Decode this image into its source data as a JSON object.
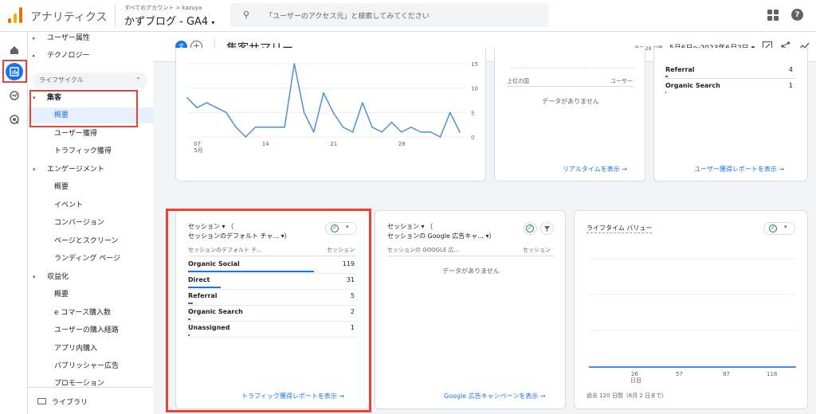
{
  "topbar": {
    "app_title": "アナリティクス",
    "breadcrumb": "すべてのアカウント > kazuya",
    "property": "かずブログ - GA4",
    "search_placeholder": "「ユーザーのアクセス元」と検索してみてください"
  },
  "nav": {
    "items": [
      {
        "label": "ユーザー属性",
        "caret": "▸"
      },
      {
        "label": "テクノロジー",
        "caret": "▸"
      },
      {
        "label": "集客",
        "caret": "▾"
      },
      {
        "label": "概要"
      },
      {
        "label": "ユーザー獲得"
      },
      {
        "label": "トラフィック獲得"
      },
      {
        "label": "エンゲージメント",
        "caret": "▾"
      },
      {
        "label": "概要"
      },
      {
        "label": "イベント"
      },
      {
        "label": "コンバージョン"
      },
      {
        "label": "ページとスクリーン"
      },
      {
        "label": "ランディング ページ"
      },
      {
        "label": "収益化",
        "caret": "▾"
      },
      {
        "label": "概要"
      },
      {
        "label": "e コマース購入数"
      },
      {
        "label": "ユーザーの購入経路"
      },
      {
        "label": "アプリ内購入"
      },
      {
        "label": "パブリッシャー広告"
      },
      {
        "label": "プロモーション"
      }
    ],
    "lifecycle": "ライフサイクル",
    "library": "ライブラリ"
  },
  "header": {
    "avatar": "す",
    "add": "+",
    "title": "集客サマリー",
    "range_label": "過去 28 日間",
    "range": "5月6日～2023年6月2日 ▾"
  },
  "line_chart": {
    "y_ticks": [
      "15",
      "10",
      "5",
      "0"
    ],
    "x_ticks": [
      "07",
      "14",
      "21",
      "28"
    ],
    "x_month": "5月"
  },
  "chart_data": {
    "type": "line",
    "x": [
      6,
      7,
      8,
      9,
      10,
      11,
      12,
      13,
      14,
      15,
      16,
      17,
      18,
      19,
      20,
      21,
      22,
      23,
      24,
      25,
      26,
      27,
      28,
      29,
      30,
      31,
      32,
      33,
      34
    ],
    "values": [
      8,
      6,
      7,
      6,
      5,
      2,
      0,
      2,
      2,
      2,
      2,
      15,
      5,
      1,
      9,
      5,
      2,
      1,
      7,
      2,
      1,
      3,
      1,
      2,
      1,
      1,
      0,
      5,
      1
    ],
    "ylim": [
      0,
      15
    ],
    "xlabel": "",
    "ylabel": ""
  },
  "realtime": {
    "col_country": "上位の国",
    "col_users": "ユーザー",
    "no_data": "データがありません",
    "link": "リアルタイムを表示 →"
  },
  "user_acq": {
    "rows": [
      {
        "label": "Referral",
        "value": "4"
      },
      {
        "label": "Organic Search",
        "value": "1"
      }
    ],
    "link": "ユーザー獲得レポートを表示 →"
  },
  "session_card": {
    "title": "セッション ▾ （",
    "subtitle": "セッションのデフォルト チャ... ▾）",
    "col_dim": "セッションのデフォルト チ...",
    "col_metric": "セッション",
    "rows": [
      {
        "label": "Organic Social",
        "value": "119",
        "frac": 1.0
      },
      {
        "label": "Direct",
        "value": "31",
        "frac": 0.26
      },
      {
        "label": "Referral",
        "value": "5",
        "frac": 0.04
      },
      {
        "label": "Organic Search",
        "value": "2",
        "frac": 0.017
      },
      {
        "label": "Unassigned",
        "value": "1",
        "frac": 0.008
      }
    ],
    "link": "トラフィック獲得レポートを表示 →"
  },
  "ads_card": {
    "title": "セッション ▾ （",
    "subtitle": "セッションの Google 広告キャ... ▾）",
    "col_dim": "セッションの GOOGLE 広...",
    "col_metric": "セッション",
    "no_data": "データがありません",
    "link": "Google 広告キャンペーンを表示 →"
  },
  "ltv_card": {
    "title": "ライフタイム バリュー",
    "x_ticks": [
      "26",
      "57",
      "87",
      "118"
    ],
    "x_unit": "日目",
    "footer": "過去 120 日間（6月 2 日まで）"
  },
  "colors": {
    "accent": "#1a73e8",
    "highlight": "#ea4335"
  }
}
